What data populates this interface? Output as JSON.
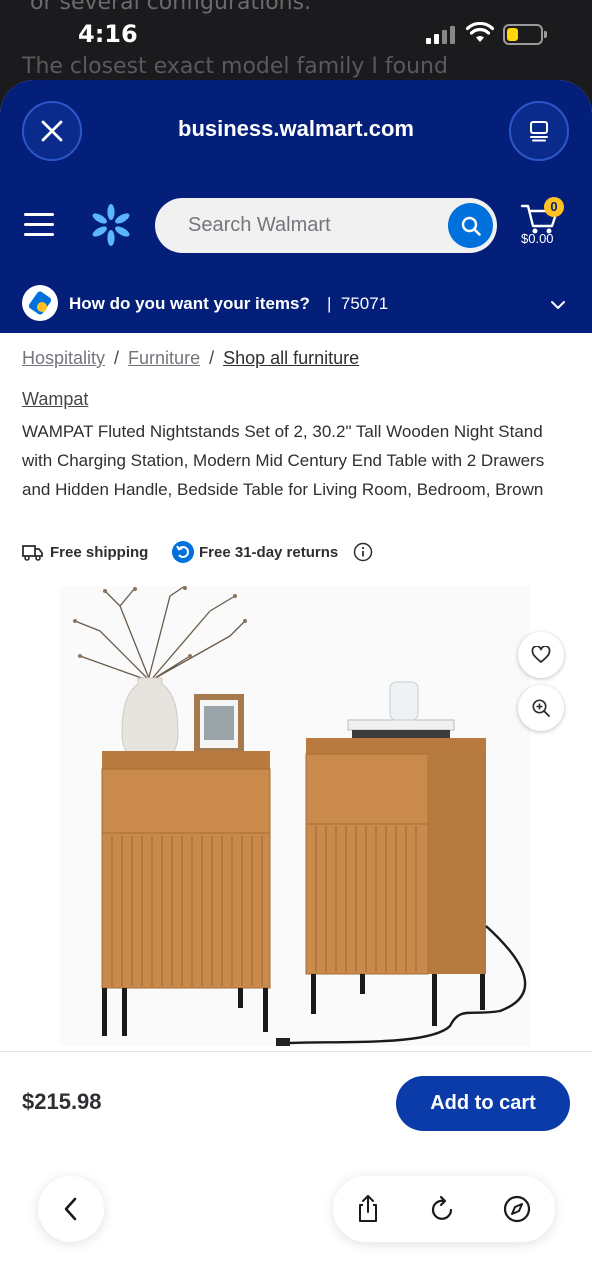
{
  "background": {
    "line1": "or several configurations.",
    "line2": "The closest exact model family I found"
  },
  "status_bar": {
    "time": "4:16"
  },
  "browser": {
    "url": "business.walmart.com"
  },
  "header": {
    "search_placeholder": "Search Walmart",
    "cart_count": "0",
    "cart_total": "$0.00"
  },
  "delivery": {
    "prompt": "How do you want your items?",
    "separator": "|",
    "zip": "75071"
  },
  "breadcrumbs": [
    "Hospitality",
    "Furniture",
    "Shop all furniture"
  ],
  "breadcrumb_separator": "/",
  "product": {
    "brand": "Wampat",
    "title": "WAMPAT Fluted Nightstands Set of 2, 30.2\" Tall Wooden Night Stand with Charging Station, Modern Mid Century End Table with 2 Drawers and Hidden Handle, Bedside Table for Living Room, Bedroom, Brown",
    "shipping": "Free shipping",
    "returns": "Free 31-day returns",
    "price": "$215.98",
    "add_to_cart": "Add to cart"
  },
  "colors": {
    "walmart_blue": "#041f7a",
    "action_blue": "#0071dc",
    "spark_yellow": "#ffc220",
    "wood": "#c98a4b"
  }
}
